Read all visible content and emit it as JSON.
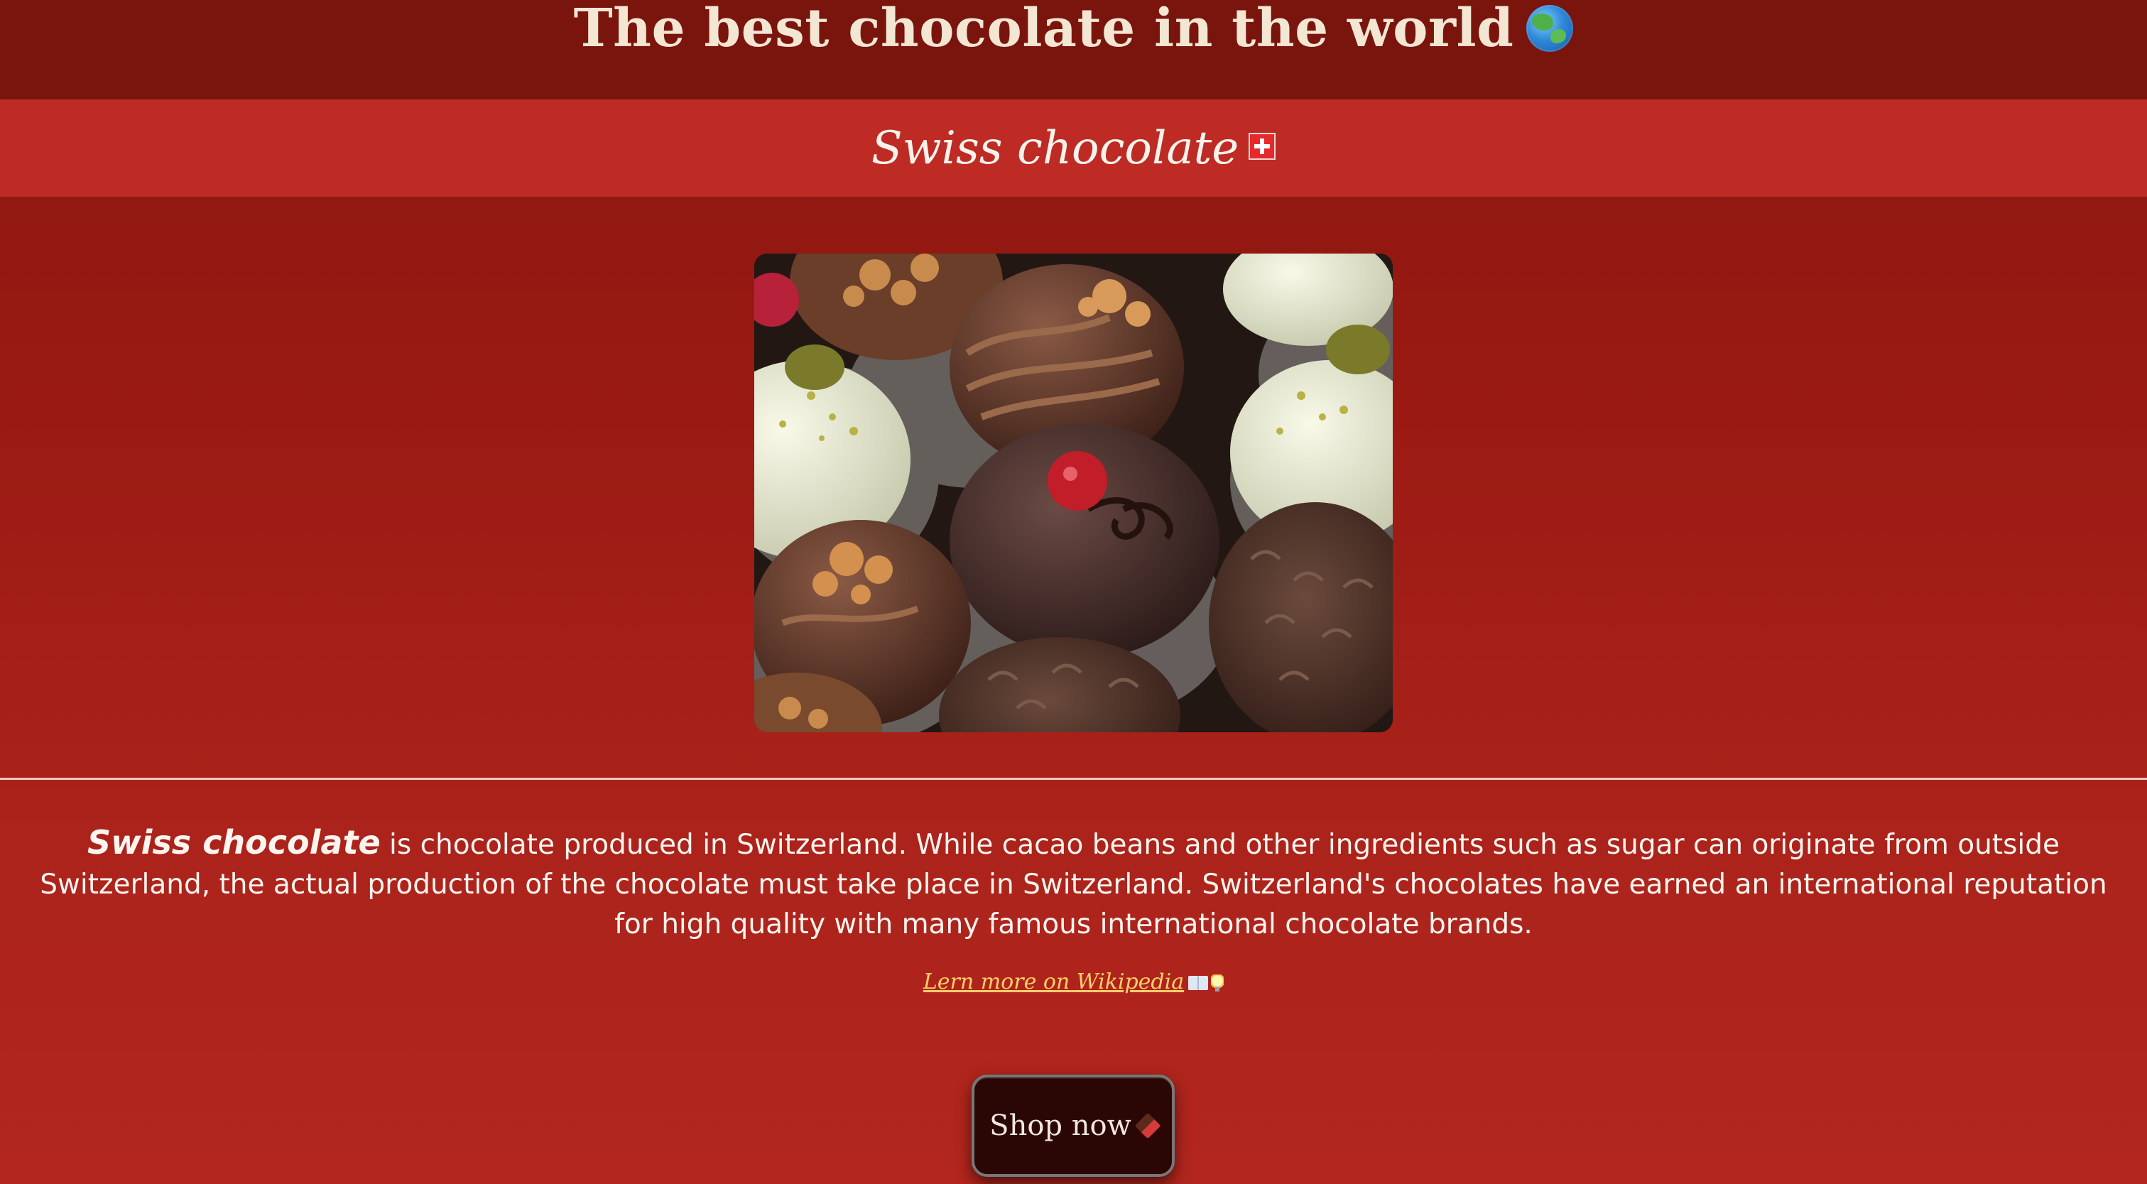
{
  "page": {
    "title": "The best chocolate in the world",
    "title_icon": "globe-icon",
    "subtitle": "Swiss chocolate",
    "subtitle_icon": "swiss-flag-icon"
  },
  "hero_image": {
    "subject": "assorted chocolate truffles and pralines",
    "colors": {
      "milk": "#6b4030",
      "dark": "#3b2320",
      "white": "#e9ebd4",
      "pistachio": "#8f8f3a",
      "cherry": "#c21e2a",
      "crisp": "#c98a4e"
    }
  },
  "description": {
    "emphasis": "Swiss chocolate",
    "text": " is chocolate produced in Switzerland. While cacao beans and other ingredients such as sugar can originate from outside Switzerland, the actual production of the chocolate must take place in Switzerland. Switzerland's chocolates have earned an international reputation for high quality with many famous international chocolate brands."
  },
  "link": {
    "label": "Lern more on Wikipedia",
    "icons": [
      "book-icon",
      "lightbulb-icon"
    ]
  },
  "cta": {
    "label": "Shop now",
    "icon": "chocolate-bar-icon"
  },
  "colors": {
    "top_bar": "#7a150e",
    "sub_bar": "#bd2b24",
    "link": "#ffcf6a",
    "button_bg": "#2a0604"
  }
}
